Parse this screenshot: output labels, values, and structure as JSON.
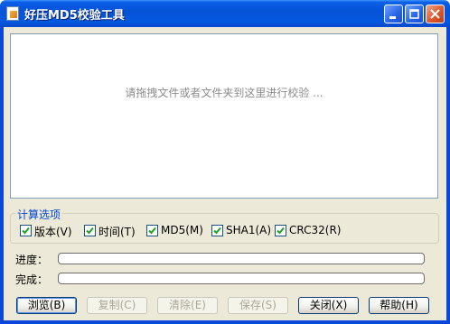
{
  "window": {
    "title": "好压MD5校验工具",
    "icon": "document-app-icon"
  },
  "dropzone": {
    "hint": "请拖拽文件或者文件夹到这里进行校验 ..."
  },
  "options": {
    "group_title": "计算选项",
    "items": [
      {
        "label": "版本(V)",
        "checked": true
      },
      {
        "label": "时间(T)",
        "checked": true
      },
      {
        "label": "MD5(M)",
        "checked": true
      },
      {
        "label": "SHA1(A)",
        "checked": true
      },
      {
        "label": "CRC32(R)",
        "checked": true
      }
    ]
  },
  "progress": {
    "label": "进度：",
    "value": 0
  },
  "complete": {
    "label": "完成：",
    "value": 0
  },
  "buttons": {
    "browse": "浏览(B)",
    "copy": "复制(C)",
    "clear": "清除(E)",
    "save": "保存(S)",
    "close": "关闭(X)",
    "help": "帮助(H)"
  }
}
